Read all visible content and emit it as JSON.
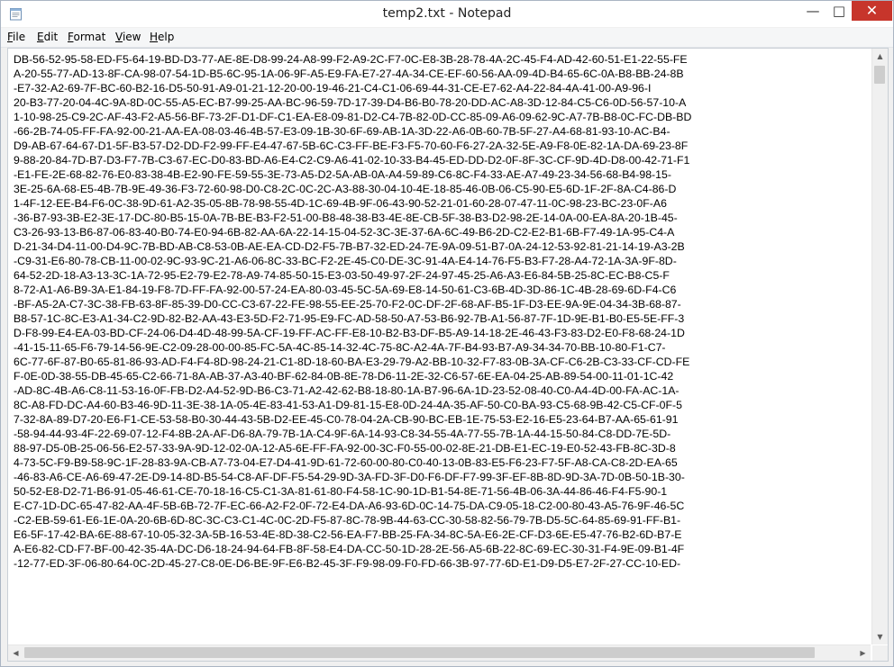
{
  "window": {
    "title": "temp2.txt - Notepad",
    "controls": {
      "minimize": "—",
      "maximize": "□",
      "close": "✕"
    }
  },
  "menu": [
    {
      "label": "File",
      "mnemonic": "F",
      "rest": "ile"
    },
    {
      "label": "Edit",
      "mnemonic": "E",
      "rest": "dit"
    },
    {
      "label": "Format",
      "mnemonic": "F",
      "rest": "ormat"
    },
    {
      "label": "View",
      "mnemonic": "V",
      "rest": "iew"
    },
    {
      "label": "Help",
      "mnemonic": "H",
      "rest": "elp"
    }
  ],
  "editor": {
    "lines": [
      "DB-56-52-95-58-ED-F5-64-19-BD-D3-77-AE-8E-D8-99-24-A8-99-F2-A9-2C-F7-0C-E8-3B-28-78-4A-2C-45-F4-AD-42-60-51-E1-22-55-FE",
      "A-20-55-77-AD-13-8F-CA-98-07-54-1D-B5-6C-95-1A-06-9F-A5-E9-FA-E7-27-4A-34-CE-EF-60-56-AA-09-4D-B4-65-6C-0A-B8-BB-24-8B",
      "-E7-32-A2-69-7F-BC-60-B2-16-D5-50-91-A9-01-21-12-20-00-19-46-21-C4-C1-06-69-44-31-CE-E7-62-A4-22-84-4A-41-00-A9-96-I",
      "20-B3-77-20-04-4C-9A-8D-0C-55-A5-EC-B7-99-25-AA-BC-96-59-7D-17-39-D4-B6-B0-78-20-DD-AC-A8-3D-12-84-C5-C6-0D-56-57-10-A",
      "1-10-98-25-C9-2C-AF-43-F2-A5-56-BF-73-2F-D1-DF-C1-EA-E8-09-81-D2-C4-7B-82-0D-CC-85-09-A6-09-62-9C-A7-7B-B8-0C-FC-DB-BD",
      "-66-2B-74-05-FF-FA-92-00-21-AA-EA-08-03-46-4B-57-E3-09-1B-30-6F-69-AB-1A-3D-22-A6-0B-60-7B-5F-27-A4-68-81-93-10-AC-B4-",
      "D9-AB-67-64-67-D1-5F-B3-57-D2-DD-F2-99-FF-E4-47-67-5B-6C-C3-FF-BE-F3-F5-70-60-F6-27-2A-32-5E-A9-F8-0E-82-1A-DA-69-23-8F",
      "9-88-20-84-7D-B7-D3-F7-7B-C3-67-EC-D0-83-BD-A6-E4-C2-C9-A6-41-02-10-33-B4-45-ED-DD-D2-0F-8F-3C-CF-9D-4D-D8-00-42-71-F1",
      "-E1-FE-2E-68-82-76-E0-83-38-4B-E2-90-FE-59-55-3E-73-A5-D2-5A-AB-0A-A4-59-89-C6-8C-F4-33-AE-A7-49-23-34-56-68-B4-98-15-",
      "3E-25-6A-68-E5-4B-7B-9E-49-36-F3-72-60-98-D0-C8-2C-0C-2C-A3-88-30-04-10-4E-18-85-46-0B-06-C5-90-E5-6D-1F-2F-8A-C4-86-D",
      "1-4F-12-EE-B4-F6-0C-38-9D-61-A2-35-05-8B-78-98-55-4D-1C-69-4B-9F-06-43-90-52-21-01-60-28-07-47-11-0C-98-23-BC-23-0F-A6",
      "-36-B7-93-3B-E2-3E-17-DC-80-B5-15-0A-7B-BE-B3-F2-51-00-B8-48-38-B3-4E-8E-CB-5F-38-B3-D2-98-2E-14-0A-00-EA-8A-20-1B-45-",
      "C3-26-93-13-B6-87-06-83-40-B0-74-E0-94-6B-82-AA-6A-22-14-15-04-52-3C-3E-37-6A-6C-49-B6-2D-C2-E2-B1-6B-F7-49-1A-95-C4-A",
      "D-21-34-D4-11-00-D4-9C-7B-BD-AB-C8-53-0B-AE-EA-CD-D2-F5-7B-B7-32-ED-24-7E-9A-09-51-B7-0A-24-12-53-92-81-21-14-19-A3-2B",
      "-C9-31-E6-80-78-CB-11-00-02-9C-93-9C-21-A6-06-8C-33-BC-F2-2E-45-C0-DE-3C-91-4A-E4-14-76-F5-B3-F7-28-A4-72-1A-3A-9F-8D-",
      "64-52-2D-18-A3-13-3C-1A-72-95-E2-79-E2-78-A9-74-85-50-15-E3-03-50-49-97-2F-24-97-45-25-A6-A3-E6-84-5B-25-8C-EC-B8-C5-F",
      "8-72-A1-A6-B9-3A-E1-84-19-F8-7D-FF-FA-92-00-57-24-EA-80-03-45-5C-5A-69-E8-14-50-61-C3-6B-4D-3D-86-1C-4B-28-69-6D-F4-C6",
      "-BF-A5-2A-C7-3C-38-FB-63-8F-85-39-D0-CC-C3-67-22-FE-98-55-EE-25-70-F2-0C-DF-2F-68-AF-B5-1F-D3-EE-9A-9E-04-34-3B-68-87-",
      "B8-57-1C-8C-E3-A1-34-C2-9D-82-B2-AA-43-E3-5D-F2-71-95-E9-FC-AD-58-50-A7-53-B6-92-7B-A1-56-87-7F-1D-9E-B1-B0-E5-5E-FF-3",
      "D-F8-99-E4-EA-03-BD-CF-24-06-D4-4D-48-99-5A-CF-19-FF-AC-FF-E8-10-B2-B3-DF-B5-A9-14-18-2E-46-43-F3-83-D2-E0-F8-68-24-1D",
      "-41-15-11-65-F6-79-14-56-9E-C2-09-28-00-00-85-FC-5A-4C-85-14-32-4C-75-8C-A2-4A-7F-B4-93-B7-A9-34-34-70-BB-10-80-F1-C7-",
      "6C-77-6F-87-B0-65-81-86-93-AD-F4-F4-8D-98-24-21-C1-8D-18-60-BA-E3-29-79-A2-BB-10-32-F7-83-0B-3A-CF-C6-2B-C3-33-CF-CD-FE",
      "F-0E-0D-38-55-DB-45-65-C2-66-71-8A-AB-37-A3-40-BF-62-84-0B-8E-78-D6-11-2E-32-C6-57-6E-EA-04-25-AB-89-54-00-11-01-1C-42",
      "-AD-8C-4B-A6-C8-11-53-16-0F-FB-D2-A4-52-9D-B6-C3-71-A2-42-62-B8-18-80-1A-B7-96-6A-1D-23-52-08-40-C0-A4-4D-00-FA-AC-1A-",
      "8C-A8-FD-DC-A4-60-B3-46-9D-11-3E-38-1A-05-4E-83-41-53-A1-D9-81-15-E8-0D-24-4A-35-AF-50-C0-BA-93-C5-68-9B-42-C5-CF-0F-5",
      "7-32-8A-89-D7-20-E6-F1-CE-53-58-B0-30-44-43-5B-D2-EE-45-C0-78-04-2A-CB-90-BC-EB-1E-75-53-E2-16-E5-23-64-B7-AA-65-61-91",
      "-58-94-44-93-4F-22-69-07-12-F4-8B-2A-AF-D6-8A-79-7B-1A-C4-9F-6A-14-93-C8-34-55-4A-77-55-7B-1A-44-15-50-84-C8-DD-7E-5D-",
      "88-97-D5-0B-25-06-56-E2-57-33-9A-9D-12-02-0A-12-A5-6E-FF-FA-92-00-3C-F0-55-00-02-8E-21-DB-E1-EC-19-E0-52-43-FB-8C-3D-8",
      "4-73-5C-F9-B9-58-9C-1F-28-83-9A-CB-A7-73-04-E7-D4-41-9D-61-72-60-00-80-C0-40-13-0B-83-E5-F6-23-F7-5F-A8-CA-C8-2D-EA-65",
      "-46-83-A6-CE-A6-69-47-2E-D9-14-8D-B5-54-C8-AF-DF-F5-54-29-9D-3A-FD-3F-D0-F6-DF-F7-99-3F-EF-8B-8D-9D-3A-7D-0B-50-1B-30-",
      "50-52-E8-D2-71-B6-91-05-46-61-CE-70-18-16-C5-C1-3A-81-61-80-F4-58-1C-90-1D-B1-54-8E-71-56-4B-06-3A-44-86-46-F4-F5-90-1",
      "E-C7-1D-DC-65-47-82-AA-4F-5B-6B-72-7F-EC-66-A2-F2-0F-72-E4-DA-A6-93-6D-0C-14-75-DA-C9-05-18-C2-00-80-43-A5-76-9F-46-5C",
      "-C2-EB-59-61-E6-1E-0A-20-6B-6D-8C-3C-C3-C1-4C-0C-2D-F5-87-8C-78-9B-44-63-CC-30-58-82-56-79-7B-D5-5C-64-85-69-91-FF-B1-",
      "E6-5F-17-42-BA-6E-88-67-10-05-32-3A-5B-16-53-4E-8D-38-C2-56-EA-F7-BB-25-FA-34-8C-5A-E6-2E-CF-D3-6E-E5-47-76-B2-6D-B7-E",
      "A-E6-82-CD-F7-BF-00-42-35-4A-DC-D6-18-24-94-64-FB-8F-58-E4-DA-CC-50-1D-28-2E-56-A5-6B-22-8C-69-EC-30-31-F4-9E-09-B1-4F",
      "-12-77-ED-3F-06-80-64-0C-2D-45-27-C8-0E-D6-BE-9F-E6-B2-45-3F-F9-98-09-F0-FD-66-3B-97-77-6D-E1-D9-D5-E7-2F-27-CC-10-ED-"
    ],
    "scroll": {
      "vertical_position": 0.0,
      "horizontal_visible_fraction": 0.95
    }
  }
}
